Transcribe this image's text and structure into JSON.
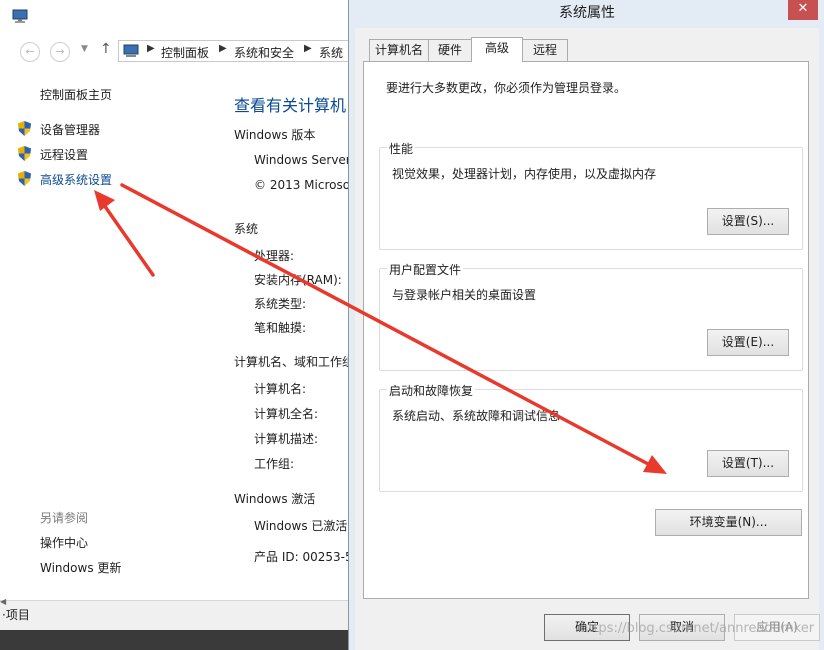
{
  "control_panel": {
    "breadcrumb": [
      "控制面板",
      "系统和安全",
      "系统"
    ],
    "left_nav": {
      "home": "控制面板主页",
      "links": [
        "设备管理器",
        "远程设置",
        "高级系统设置"
      ],
      "see_also_title": "另请参阅",
      "see_also": [
        "操作中心",
        "Windows 更新"
      ]
    },
    "main": {
      "title": "查看有关计算机",
      "edition_heading": "Windows 版本",
      "edition_name": "Windows Server",
      "copyright": "© 2013 Microso",
      "system_heading": "系统",
      "processor": "处理器:",
      "ram": "安装内存(RAM):",
      "system_type": "系统类型:",
      "pen_touch": "笔和触摸:",
      "computer_heading": "计算机名、域和工作组",
      "computer_name": "计算机名:",
      "full_name": "计算机全名:",
      "description": "计算机描述:",
      "workgroup": "工作组:",
      "activation_heading": "Windows 激活",
      "activation_status": "Windows 已激活",
      "product_id": "产品 ID: 00253-5"
    },
    "status_text": "·项目"
  },
  "dialog": {
    "title": "系统属性",
    "close": "✕",
    "tabs": [
      "计算机名",
      "硬件",
      "高级",
      "远程"
    ],
    "active_tab": "高级",
    "intro": "要进行大多数更改，你必须作为管理员登录。",
    "groups": [
      {
        "title": "性能",
        "desc": "视觉效果，处理器计划，内存使用，以及虚拟内存",
        "button": "设置(S)..."
      },
      {
        "title": "用户配置文件",
        "desc": "与登录帐户相关的桌面设置",
        "button": "设置(E)..."
      },
      {
        "title": "启动和故障恢复",
        "desc": "系统启动、系统故障和调试信息",
        "button": "设置(T)..."
      }
    ],
    "env_button": "环境变量(N)...",
    "ok": "确定",
    "cancel": "取消",
    "apply": "应用(A)"
  },
  "watermark": "https://blog.csdn.net/annreaddmker",
  "colors": {
    "link_blue": "#0a4a92",
    "arrow_red": "#e8392c",
    "dialog_frame": "#e3ebf4"
  }
}
